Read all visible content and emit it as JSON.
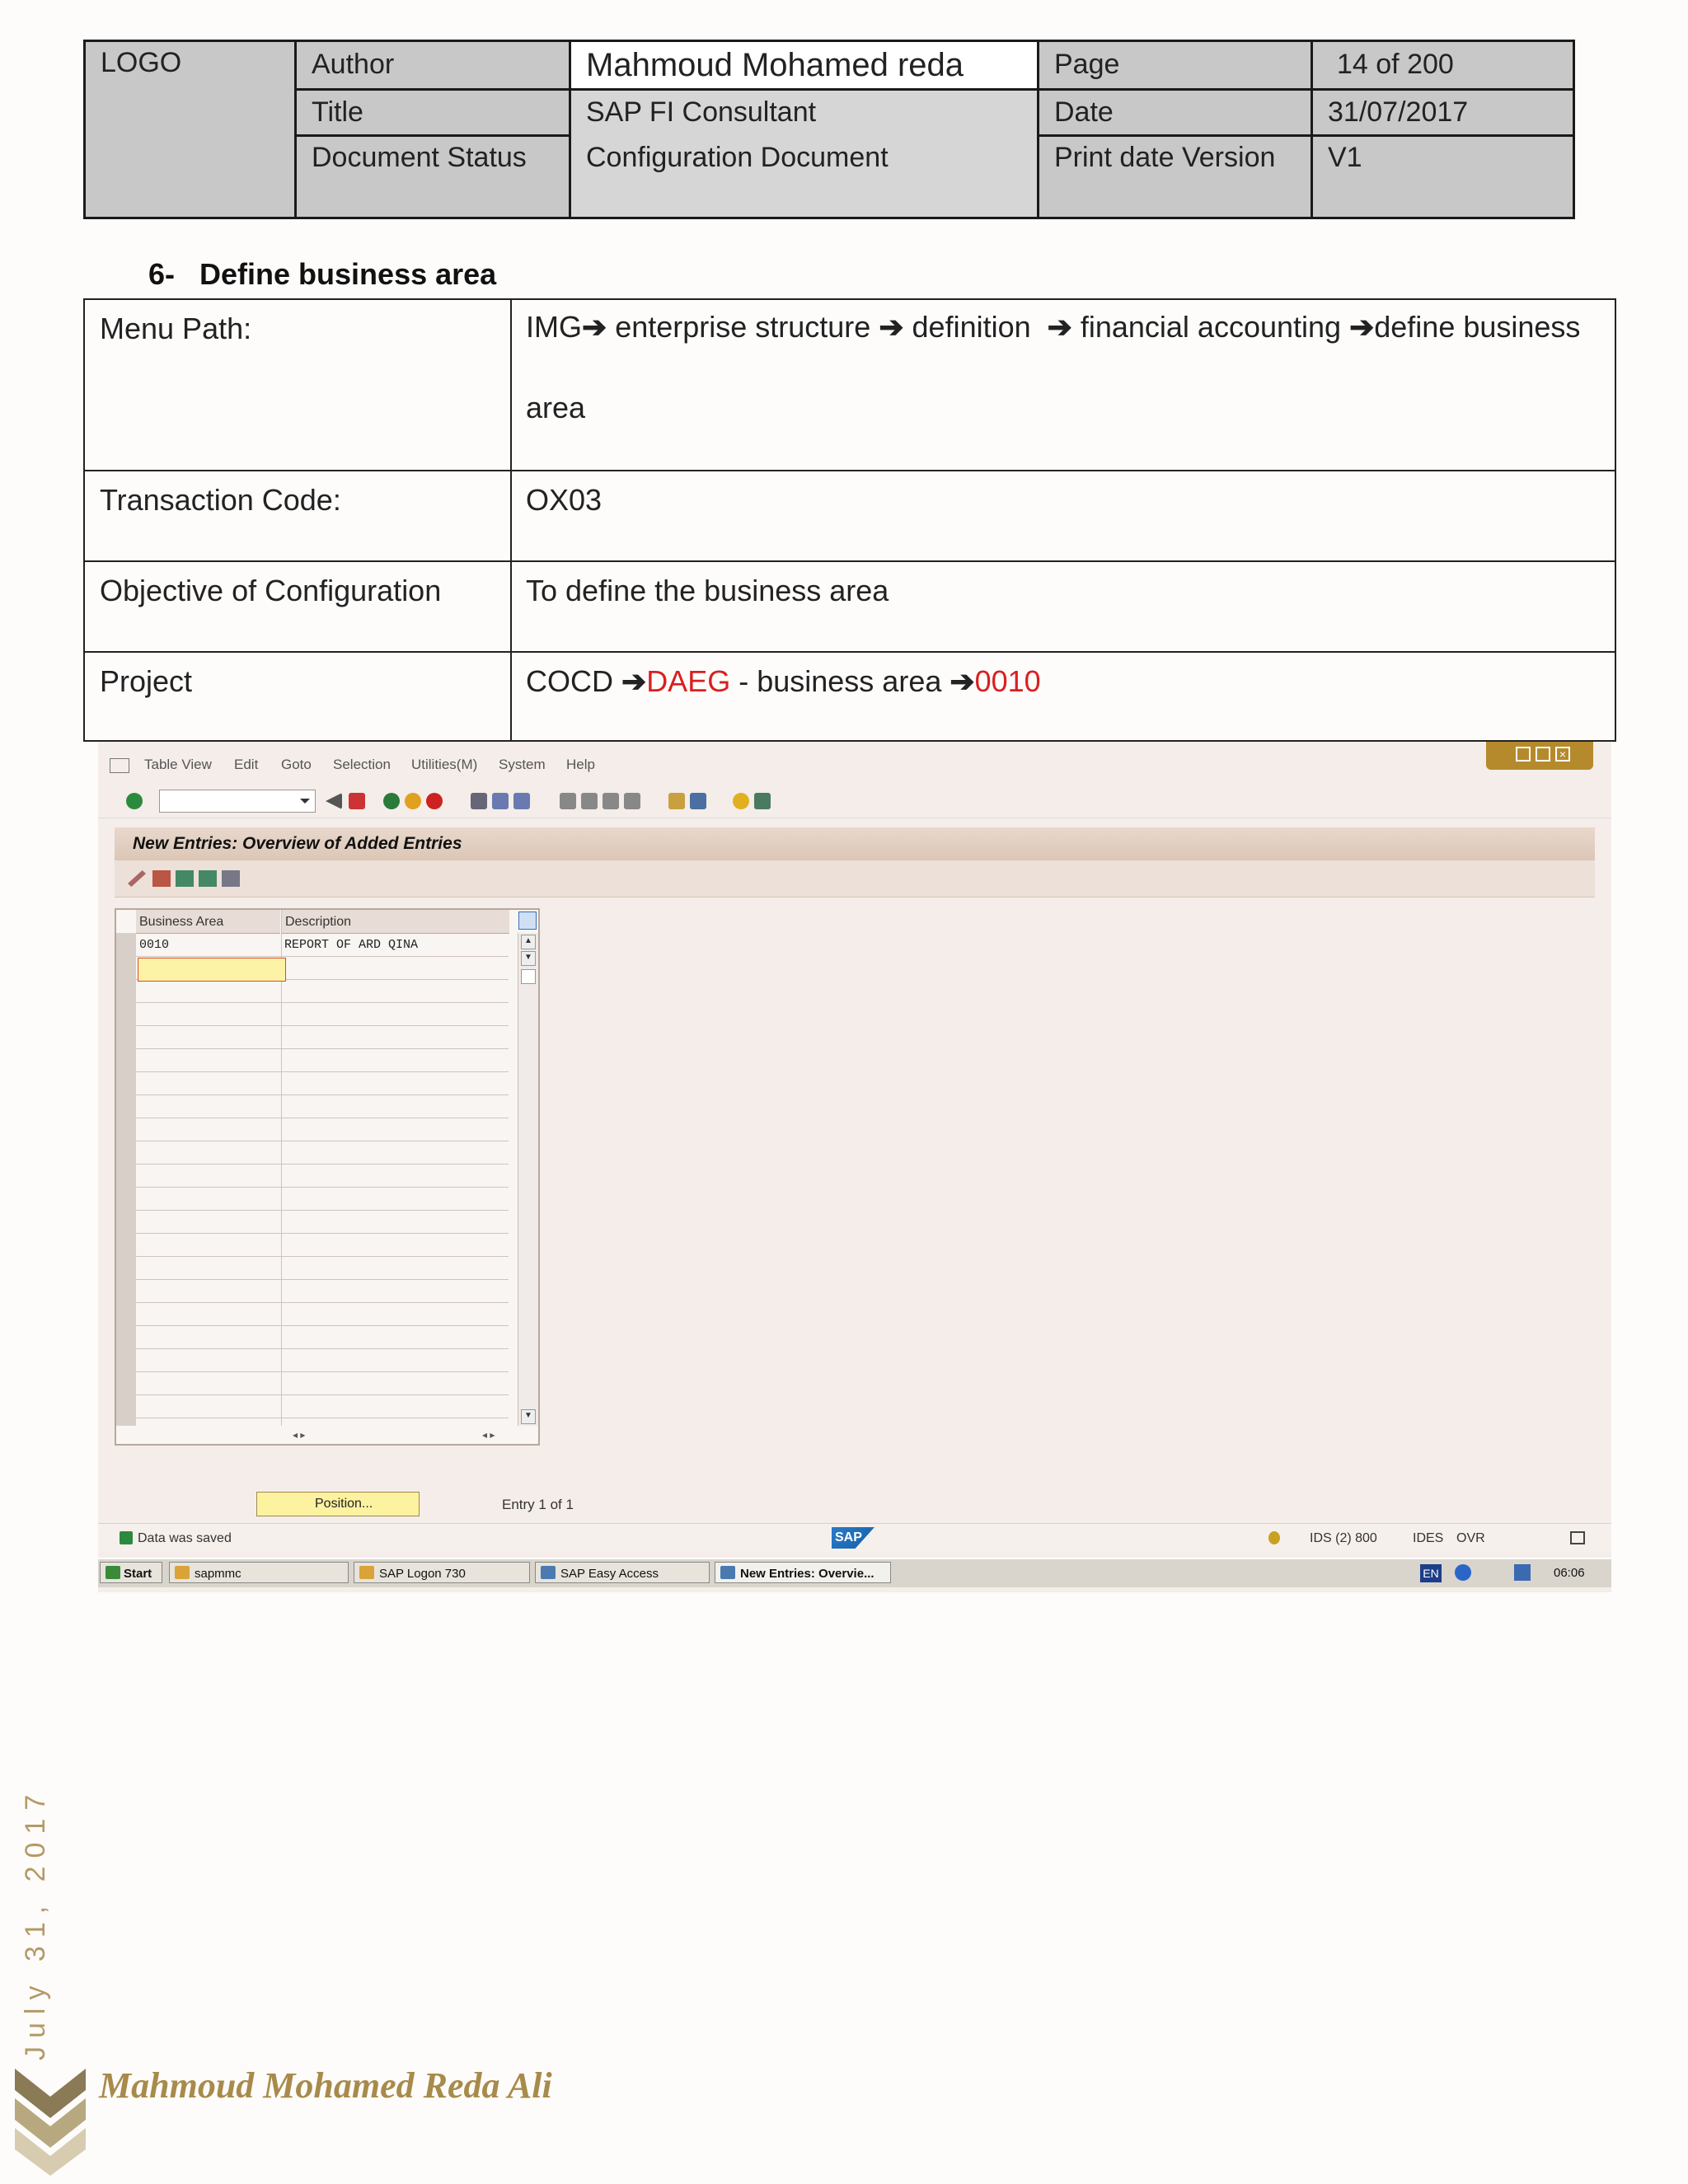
{
  "header": {
    "logo": "LOGO",
    "author_label": "Author",
    "author_value": "Mahmoud Mohamed reda",
    "page_label": "Page",
    "page_value": "14 of 200",
    "title_label": "Title",
    "title_value": "SAP FI Consultant",
    "date_label": "Date",
    "date_value": "31/07/2017",
    "status_label": "Document Status",
    "status_value": "Configuration Document",
    "version_label": "Print date Version",
    "version_value": "V1"
  },
  "section": {
    "number": "6-",
    "title": "Define business area"
  },
  "info": {
    "menu_path_label": "Menu Path:",
    "menu_path_parts": [
      "IMG",
      "enterprise structure",
      "definition",
      "financial accounting",
      "define business area"
    ],
    "transaction_label": "Transaction Code:",
    "transaction_value": "OX03",
    "objective_label": "Objective of Configuration",
    "objective_value": "To define the business area",
    "project_label": "Project",
    "project_cocd": "COCD",
    "project_company": "DAEG",
    "project_mid": "- business area",
    "project_area": "0010",
    "arrow_glyph": "➔",
    "highlight_color": "#d82020"
  },
  "sap": {
    "menu": [
      "Table View",
      "Edit",
      "Goto",
      "Selection",
      "Utilities(M)",
      "System",
      "Help"
    ],
    "screen_title": "New Entries: Overview of Added Entries",
    "table": {
      "columns": [
        "Business Area",
        "Description"
      ],
      "rows": [
        {
          "business_area": "0010",
          "description": "REPORT OF ARD QINA"
        }
      ]
    },
    "position_button": "Position...",
    "entry_text": "Entry 1 of 1",
    "status_message": "Data was saved",
    "system_info": "IDS (2) 800",
    "server": "IDES",
    "mode": "OVR",
    "logo_text": "SAP"
  },
  "taskbar": {
    "start": "Start",
    "items": [
      "sapmmc",
      "SAP Logon 730",
      "SAP Easy Access",
      "New Entries: Overvie..."
    ],
    "lang": "EN",
    "time": "06:06"
  },
  "footer": {
    "date": "July 31, 2017",
    "author": "Mahmoud Mohamed Reda Ali",
    "accent_color": "#a88a4a"
  }
}
